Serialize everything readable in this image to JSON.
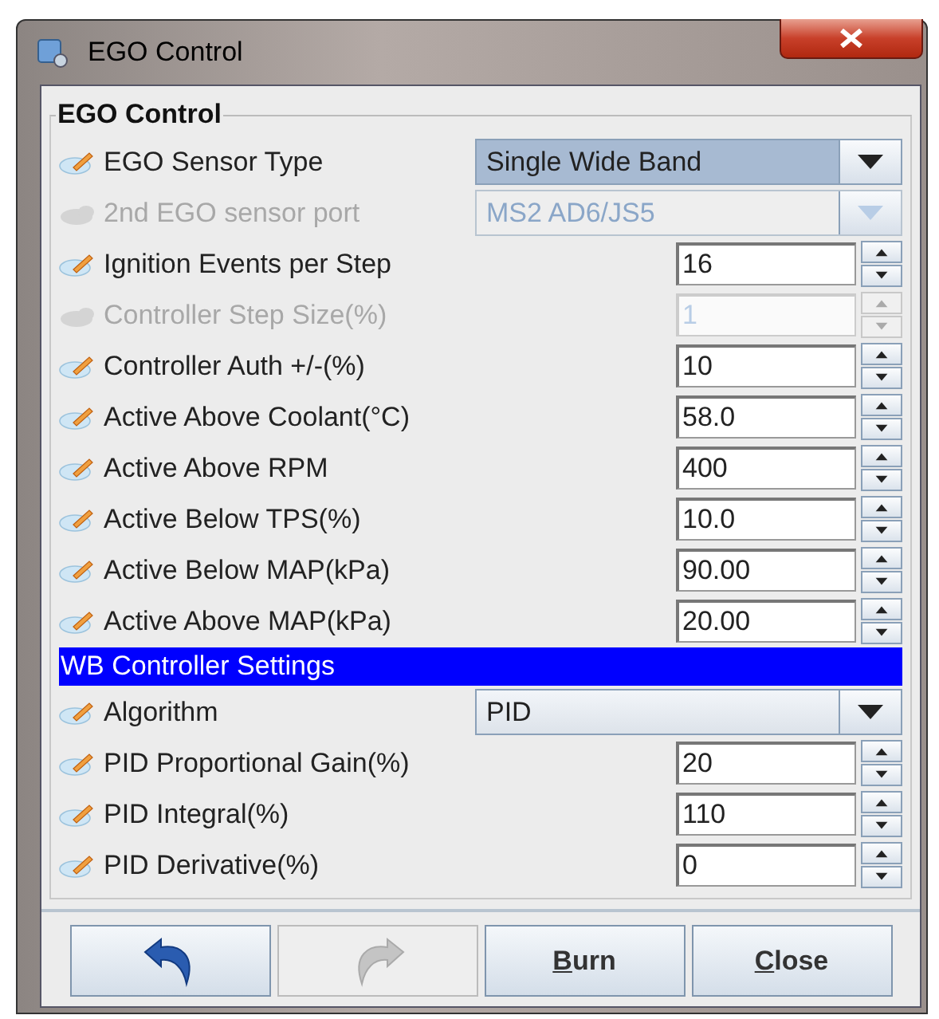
{
  "window": {
    "title": "EGO Control"
  },
  "group": {
    "title": "EGO Control"
  },
  "rows": [
    {
      "kind": "combo",
      "label": "EGO Sensor Type",
      "value": "Single Wide Band",
      "disabled": false,
      "focused": true
    },
    {
      "kind": "combo",
      "label": "2nd EGO sensor port",
      "value": "MS2 AD6/JS5",
      "disabled": true,
      "focused": false
    },
    {
      "kind": "spinner",
      "label": "Ignition Events per Step",
      "value": "16",
      "disabled": false
    },
    {
      "kind": "spinner",
      "label": "Controller Step Size(%)",
      "value": "1",
      "disabled": true
    },
    {
      "kind": "spinner",
      "label": "Controller Auth +/-(%)",
      "value": "10",
      "disabled": false
    },
    {
      "kind": "spinner",
      "label": "Active Above Coolant(°C)",
      "value": "58.0",
      "disabled": false
    },
    {
      "kind": "spinner",
      "label": "Active Above RPM",
      "value": "400",
      "disabled": false
    },
    {
      "kind": "spinner",
      "label": "Active Below TPS(%)",
      "value": "10.0",
      "disabled": false
    },
    {
      "kind": "spinner",
      "label": "Active Below MAP(kPa)",
      "value": "90.00",
      "disabled": false
    },
    {
      "kind": "spinner",
      "label": "Active Above MAP(kPa)",
      "value": "20.00",
      "disabled": false
    },
    {
      "kind": "header",
      "label": "WB Controller Settings"
    },
    {
      "kind": "combo",
      "label": "Algorithm",
      "value": "PID",
      "disabled": false,
      "focused": false
    },
    {
      "kind": "spinner",
      "label": "PID Proportional Gain(%)",
      "value": "20",
      "disabled": false
    },
    {
      "kind": "spinner",
      "label": "PID Integral(%)",
      "value": "110",
      "disabled": false
    },
    {
      "kind": "spinner",
      "label": "PID Derivative(%)",
      "value": "0",
      "disabled": false
    }
  ],
  "buttons": [
    {
      "kind": "undo",
      "disabled": false
    },
    {
      "kind": "redo",
      "disabled": true
    },
    {
      "kind": "text",
      "label": "Burn",
      "mnemonic_first": true,
      "disabled": false
    },
    {
      "kind": "text",
      "label": "Close",
      "mnemonic_first": true,
      "disabled": false
    }
  ]
}
